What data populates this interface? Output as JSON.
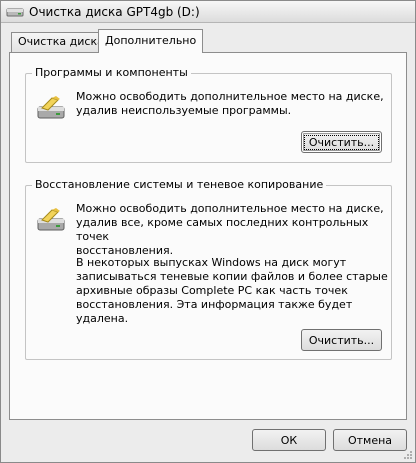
{
  "window": {
    "title": "Очистка диска GPT4gb (D:)"
  },
  "tabs": [
    {
      "label": "Очистка диска",
      "active": false
    },
    {
      "label": "Дополнительно",
      "active": true
    }
  ],
  "programs": {
    "group_title": "Программы и компоненты",
    "description": "Можно освободить дополнительное место на диске,\nудалив неиспользуемые программы.",
    "button_label": "Очистить..."
  },
  "restore": {
    "group_title": "Восстановление системы и теневое копирование",
    "description": "Можно освободить дополнительное место на диске,\nудалив все, кроме самых последних контрольных точек\nвосстановления.",
    "description2": "В некоторых выпусках Windows на диск могут\nзаписываться теневые копии файлов и более старые\nархивные образы Complete PC как часть точек\nвосстановления. Эта информация также будет удалена.",
    "button_label": "Очистить..."
  },
  "footer": {
    "ok_label": "ОК",
    "cancel_label": "Отмена"
  },
  "icons": {
    "title": "drive-cleanup-icon",
    "programs": "disk-cleanup-icon",
    "restore": "disk-cleanup-icon"
  }
}
